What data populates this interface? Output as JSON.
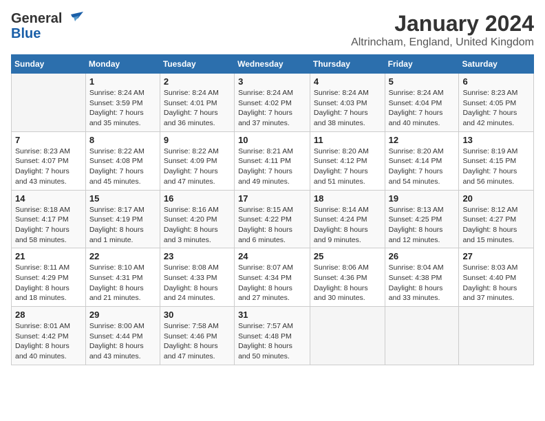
{
  "logo": {
    "line1": "General",
    "line2": "Blue"
  },
  "title": "January 2024",
  "subtitle": "Altrincham, England, United Kingdom",
  "headers": [
    "Sunday",
    "Monday",
    "Tuesday",
    "Wednesday",
    "Thursday",
    "Friday",
    "Saturday"
  ],
  "weeks": [
    [
      {
        "num": "",
        "detail": ""
      },
      {
        "num": "1",
        "detail": "Sunrise: 8:24 AM\nSunset: 3:59 PM\nDaylight: 7 hours\nand 35 minutes."
      },
      {
        "num": "2",
        "detail": "Sunrise: 8:24 AM\nSunset: 4:01 PM\nDaylight: 7 hours\nand 36 minutes."
      },
      {
        "num": "3",
        "detail": "Sunrise: 8:24 AM\nSunset: 4:02 PM\nDaylight: 7 hours\nand 37 minutes."
      },
      {
        "num": "4",
        "detail": "Sunrise: 8:24 AM\nSunset: 4:03 PM\nDaylight: 7 hours\nand 38 minutes."
      },
      {
        "num": "5",
        "detail": "Sunrise: 8:24 AM\nSunset: 4:04 PM\nDaylight: 7 hours\nand 40 minutes."
      },
      {
        "num": "6",
        "detail": "Sunrise: 8:23 AM\nSunset: 4:05 PM\nDaylight: 7 hours\nand 42 minutes."
      }
    ],
    [
      {
        "num": "7",
        "detail": "Sunrise: 8:23 AM\nSunset: 4:07 PM\nDaylight: 7 hours\nand 43 minutes."
      },
      {
        "num": "8",
        "detail": "Sunrise: 8:22 AM\nSunset: 4:08 PM\nDaylight: 7 hours\nand 45 minutes."
      },
      {
        "num": "9",
        "detail": "Sunrise: 8:22 AM\nSunset: 4:09 PM\nDaylight: 7 hours\nand 47 minutes."
      },
      {
        "num": "10",
        "detail": "Sunrise: 8:21 AM\nSunset: 4:11 PM\nDaylight: 7 hours\nand 49 minutes."
      },
      {
        "num": "11",
        "detail": "Sunrise: 8:20 AM\nSunset: 4:12 PM\nDaylight: 7 hours\nand 51 minutes."
      },
      {
        "num": "12",
        "detail": "Sunrise: 8:20 AM\nSunset: 4:14 PM\nDaylight: 7 hours\nand 54 minutes."
      },
      {
        "num": "13",
        "detail": "Sunrise: 8:19 AM\nSunset: 4:15 PM\nDaylight: 7 hours\nand 56 minutes."
      }
    ],
    [
      {
        "num": "14",
        "detail": "Sunrise: 8:18 AM\nSunset: 4:17 PM\nDaylight: 7 hours\nand 58 minutes."
      },
      {
        "num": "15",
        "detail": "Sunrise: 8:17 AM\nSunset: 4:19 PM\nDaylight: 8 hours\nand 1 minute."
      },
      {
        "num": "16",
        "detail": "Sunrise: 8:16 AM\nSunset: 4:20 PM\nDaylight: 8 hours\nand 3 minutes."
      },
      {
        "num": "17",
        "detail": "Sunrise: 8:15 AM\nSunset: 4:22 PM\nDaylight: 8 hours\nand 6 minutes."
      },
      {
        "num": "18",
        "detail": "Sunrise: 8:14 AM\nSunset: 4:24 PM\nDaylight: 8 hours\nand 9 minutes."
      },
      {
        "num": "19",
        "detail": "Sunrise: 8:13 AM\nSunset: 4:25 PM\nDaylight: 8 hours\nand 12 minutes."
      },
      {
        "num": "20",
        "detail": "Sunrise: 8:12 AM\nSunset: 4:27 PM\nDaylight: 8 hours\nand 15 minutes."
      }
    ],
    [
      {
        "num": "21",
        "detail": "Sunrise: 8:11 AM\nSunset: 4:29 PM\nDaylight: 8 hours\nand 18 minutes."
      },
      {
        "num": "22",
        "detail": "Sunrise: 8:10 AM\nSunset: 4:31 PM\nDaylight: 8 hours\nand 21 minutes."
      },
      {
        "num": "23",
        "detail": "Sunrise: 8:08 AM\nSunset: 4:33 PM\nDaylight: 8 hours\nand 24 minutes."
      },
      {
        "num": "24",
        "detail": "Sunrise: 8:07 AM\nSunset: 4:34 PM\nDaylight: 8 hours\nand 27 minutes."
      },
      {
        "num": "25",
        "detail": "Sunrise: 8:06 AM\nSunset: 4:36 PM\nDaylight: 8 hours\nand 30 minutes."
      },
      {
        "num": "26",
        "detail": "Sunrise: 8:04 AM\nSunset: 4:38 PM\nDaylight: 8 hours\nand 33 minutes."
      },
      {
        "num": "27",
        "detail": "Sunrise: 8:03 AM\nSunset: 4:40 PM\nDaylight: 8 hours\nand 37 minutes."
      }
    ],
    [
      {
        "num": "28",
        "detail": "Sunrise: 8:01 AM\nSunset: 4:42 PM\nDaylight: 8 hours\nand 40 minutes."
      },
      {
        "num": "29",
        "detail": "Sunrise: 8:00 AM\nSunset: 4:44 PM\nDaylight: 8 hours\nand 43 minutes."
      },
      {
        "num": "30",
        "detail": "Sunrise: 7:58 AM\nSunset: 4:46 PM\nDaylight: 8 hours\nand 47 minutes."
      },
      {
        "num": "31",
        "detail": "Sunrise: 7:57 AM\nSunset: 4:48 PM\nDaylight: 8 hours\nand 50 minutes."
      },
      {
        "num": "",
        "detail": ""
      },
      {
        "num": "",
        "detail": ""
      },
      {
        "num": "",
        "detail": ""
      }
    ]
  ]
}
